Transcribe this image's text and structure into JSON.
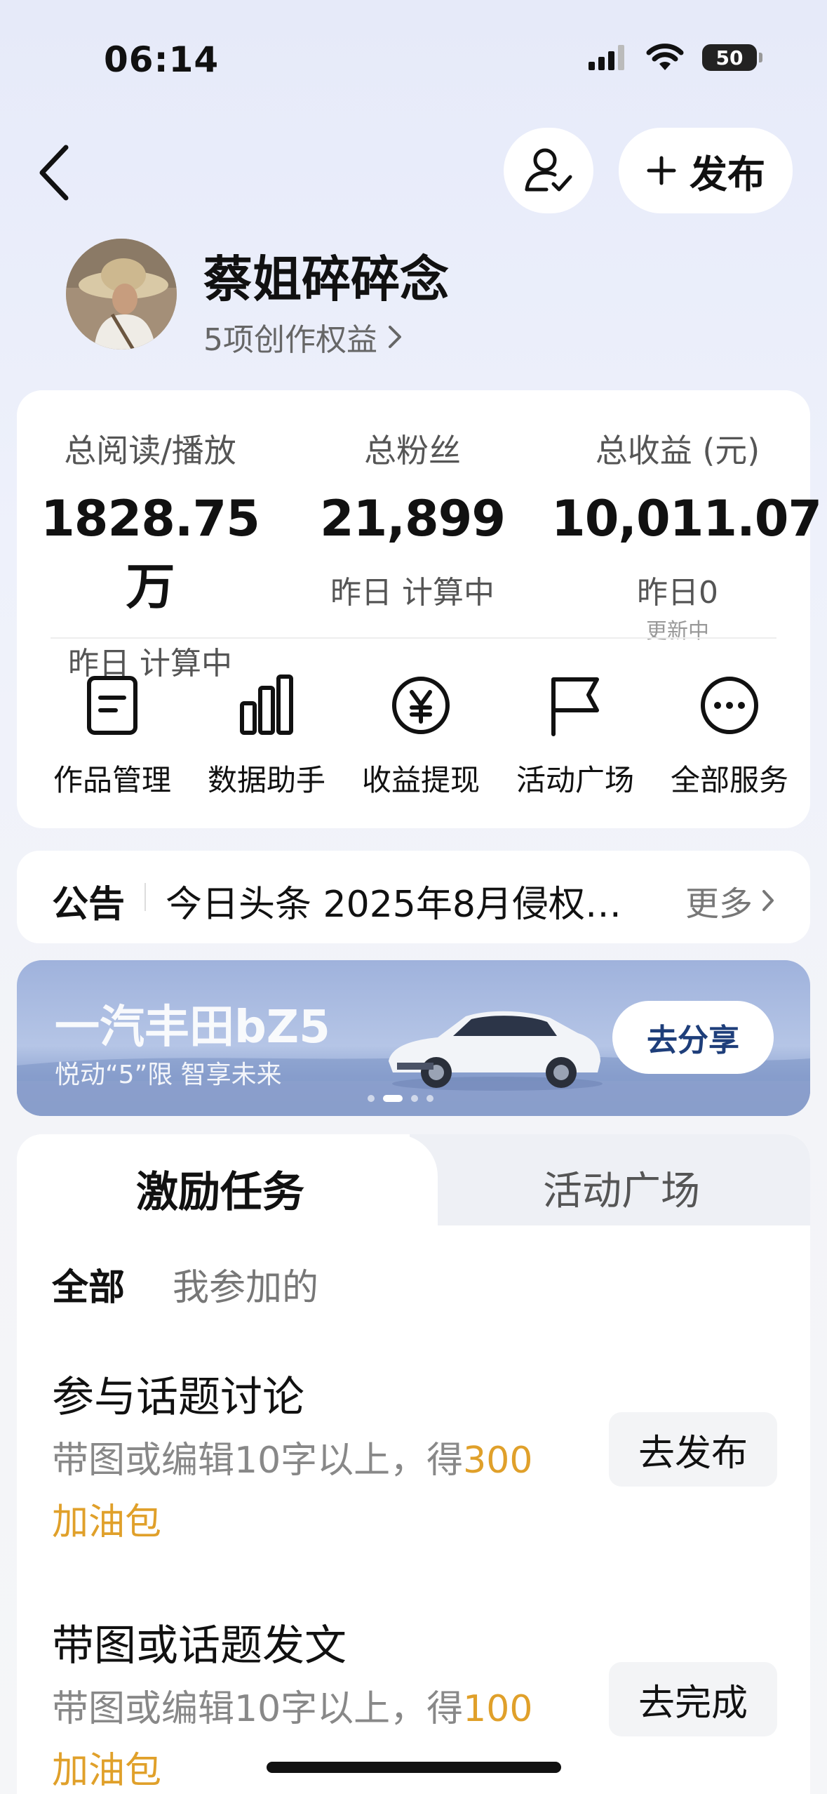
{
  "status_bar": {
    "time": "06:14",
    "battery": "50"
  },
  "nav": {
    "publish_label": "发布"
  },
  "profile": {
    "name": "蔡姐碎碎念",
    "benefits": "5项创作权益"
  },
  "stats": [
    {
      "label": "总阅读/播放",
      "value": "1828.75万",
      "sub": "昨日 计算中",
      "note": ""
    },
    {
      "label": "总粉丝",
      "value": "21,899",
      "sub": "昨日 计算中",
      "note": ""
    },
    {
      "label": "总收益 (元)",
      "value": "10,011.07",
      "sub": "昨日0",
      "note": "更新中"
    }
  ],
  "services": [
    {
      "label": "作品管理",
      "icon": "document-icon"
    },
    {
      "label": "数据助手",
      "icon": "bar-chart-icon"
    },
    {
      "label": "收益提现",
      "icon": "yuan-icon"
    },
    {
      "label": "活动广场",
      "icon": "flag-icon"
    },
    {
      "label": "全部服务",
      "icon": "more-icon"
    }
  ],
  "notice": {
    "title": "公告",
    "text": "今日头条 2025年8月侵权…",
    "more": "更多"
  },
  "banner": {
    "title": "一汽丰田bZ5",
    "subtitle": "悦动“5”限 智享未来",
    "button": "去分享",
    "active_dot": 1,
    "dot_count": 4
  },
  "tabs": {
    "active": "激励任务",
    "inactive": "活动广场"
  },
  "filters": {
    "all": "全部",
    "joined": "我参加的"
  },
  "tasks": [
    {
      "title": "参与话题讨论",
      "desc_prefix": "带图或编辑10字以上，得",
      "reward": "300",
      "reward_unit": "加油包",
      "button": "去发布"
    },
    {
      "title": "带图或话题发文",
      "desc_prefix": "带图或编辑10字以上，得",
      "reward": "100",
      "reward_unit": "加油包",
      "button": "去完成"
    }
  ],
  "colors": {
    "accent": "#e0a02a",
    "banner_button_text": "#1e3e7a"
  }
}
